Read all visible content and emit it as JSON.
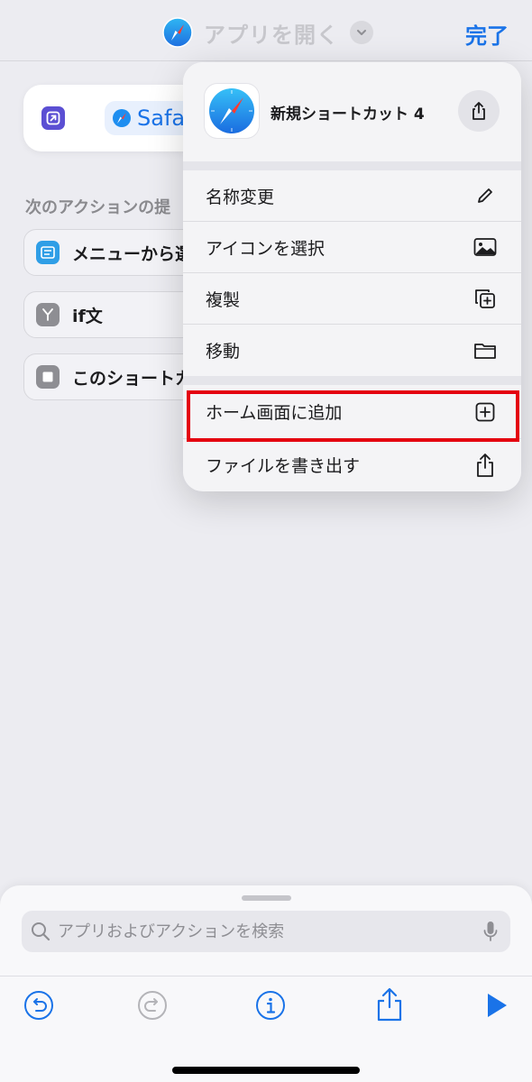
{
  "nav": {
    "title": "アプリを開く",
    "done_label": "完了",
    "app_icon": "safari-compass-icon"
  },
  "action_card": {
    "app_name": "Safari",
    "icon": "open-app-icon"
  },
  "suggestions": {
    "header": "次のアクションの提",
    "items": [
      {
        "label": "メニューから選",
        "icon": "menu-icon",
        "color": "#2f9ee6"
      },
      {
        "label": "if文",
        "icon": "branch-icon",
        "color": "#8e8e93"
      },
      {
        "label": "このショートカ",
        "icon": "stop-icon",
        "color": "#8e8e93"
      }
    ]
  },
  "popover": {
    "shortcut_name": "新規ショートカット 4",
    "items": [
      {
        "label": "名称変更",
        "icon": "pencil-icon"
      },
      {
        "label": "アイコンを選択",
        "icon": "photo-icon"
      },
      {
        "label": "複製",
        "icon": "duplicate-icon"
      },
      {
        "label": "移動",
        "icon": "folder-icon"
      },
      {
        "label": "ホーム画面に追加",
        "icon": "add-square-icon",
        "highlighted": true
      },
      {
        "label": "ファイルを書き出す",
        "icon": "export-icon"
      }
    ]
  },
  "search": {
    "placeholder": "アプリおよびアクションを検索",
    "value": ""
  },
  "toolbar": {
    "buttons": [
      "undo-icon",
      "redo-icon",
      "info-icon",
      "share-icon",
      "play-icon"
    ]
  },
  "colors": {
    "accent": "#1a73e8",
    "highlight": "#e4000f",
    "background": "#ececf1"
  }
}
